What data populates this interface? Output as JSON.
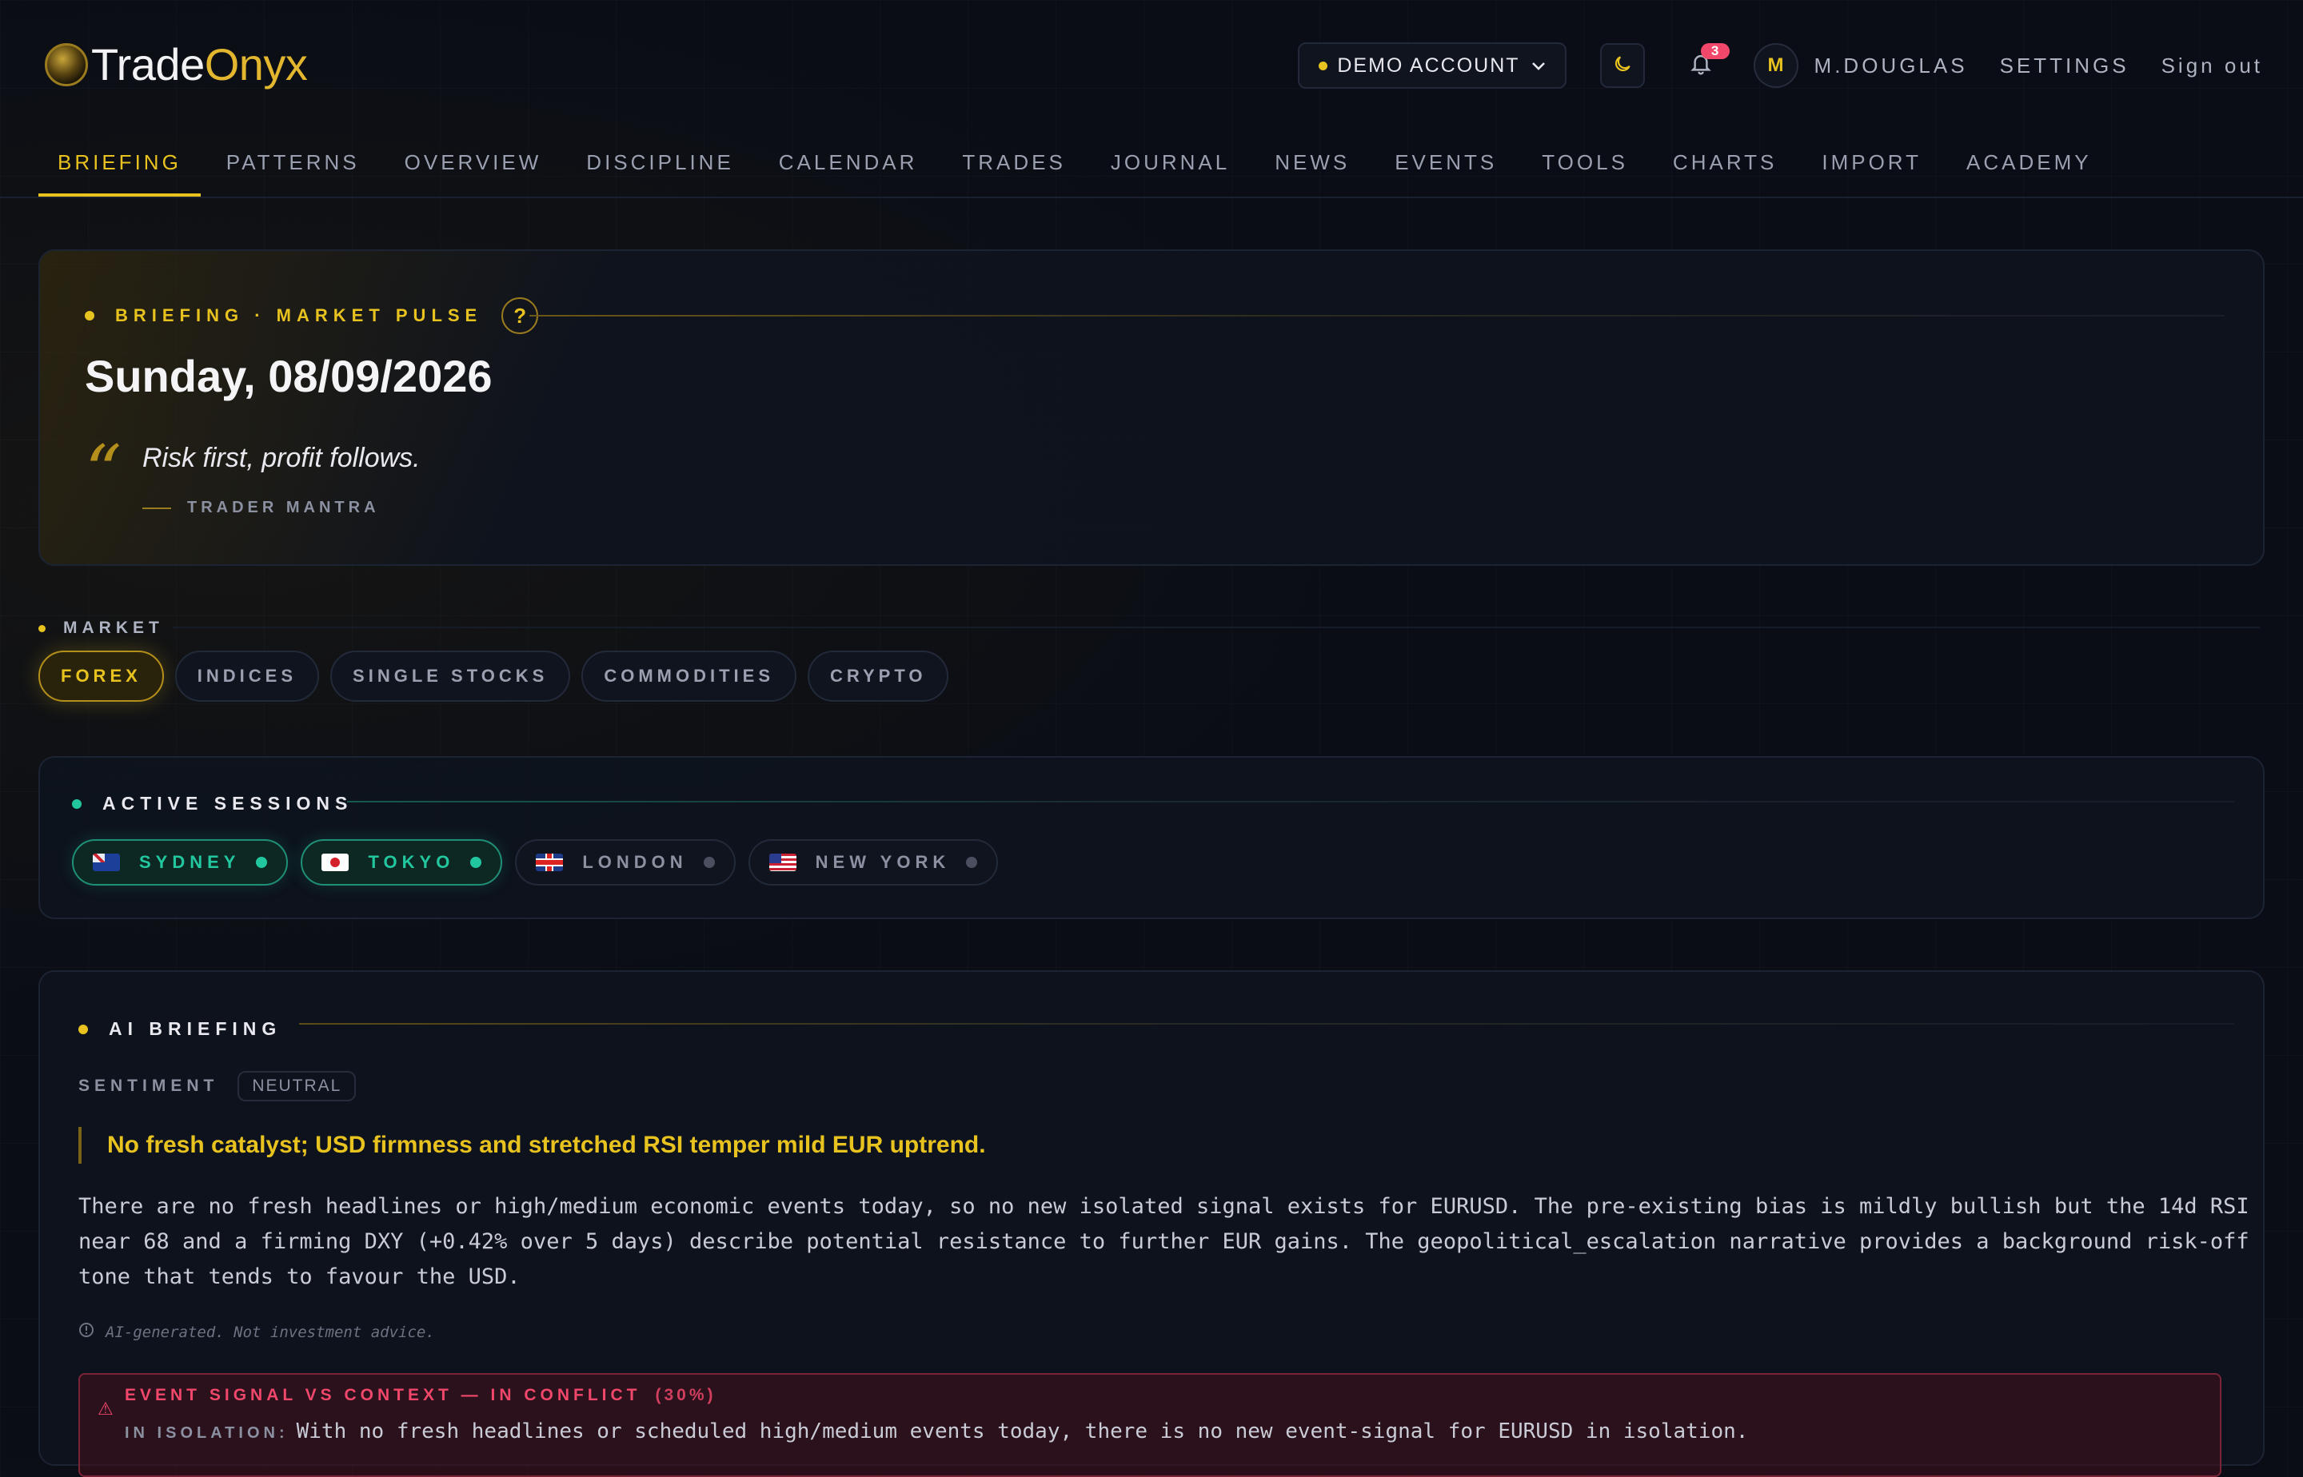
{
  "brand": {
    "part1": "Trade",
    "part2": "Onyx"
  },
  "topbar": {
    "account_label": "DEMO ACCOUNT",
    "notification_count": "3",
    "avatar_initial": "M",
    "username": "M.DOUGLAS",
    "settings": "SETTINGS",
    "signout": "Sign out"
  },
  "nav": [
    "BRIEFING",
    "PATTERNS",
    "OVERVIEW",
    "DISCIPLINE",
    "CALENDAR",
    "TRADES",
    "JOURNAL",
    "NEWS",
    "EVENTS",
    "TOOLS",
    "CHARTS",
    "IMPORT",
    "ACADEMY"
  ],
  "pulse": {
    "label": "BRIEFING · MARKET PULSE",
    "help": "?",
    "date": "Sunday, 08/09/2026",
    "quote": "Risk first, profit follows.",
    "source": "TRADER MANTRA"
  },
  "market": {
    "label": "MARKET",
    "options": [
      "FOREX",
      "INDICES",
      "SINGLE STOCKS",
      "COMMODITIES",
      "CRYPTO"
    ],
    "selected": "FOREX"
  },
  "sessions": {
    "label": "ACTIVE SESSIONS",
    "items": [
      {
        "name": "SYDNEY",
        "active": true
      },
      {
        "name": "TOKYO",
        "active": true
      },
      {
        "name": "LONDON",
        "active": false
      },
      {
        "name": "NEW YORK",
        "active": false
      }
    ]
  },
  "ai": {
    "label": "AI BRIEFING",
    "sentiment_label": "SENTIMENT",
    "sentiment": "NEUTRAL",
    "headline": "No fresh catalyst; USD firmness and stretched RSI temper mild EUR uptrend.",
    "body": "There are no fresh headlines or high/medium economic events today, so no new isolated signal exists for EURUSD. The pre-existing bias is mildly bullish but the 14d RSI near 68 and a firming DXY (+0.42% over 5 days) describe potential resistance to further EUR gains. The geopolitical_escalation narrative provides a background risk-off tone that tends to favour the USD.",
    "disclaimer": "AI-generated. Not investment advice.",
    "conflict_title": "EVENT SIGNAL VS CONTEXT — IN CONFLICT",
    "conflict_pct": "(30%)",
    "isolation_label": "IN ISOLATION:",
    "isolation_text": "With no fresh headlines or scheduled high/medium events today, there is no new event-signal for EURUSD in isolation."
  },
  "colors": {
    "accent": "#e8c21f",
    "session_on": "#22c7a0",
    "danger": "#f0476a"
  }
}
